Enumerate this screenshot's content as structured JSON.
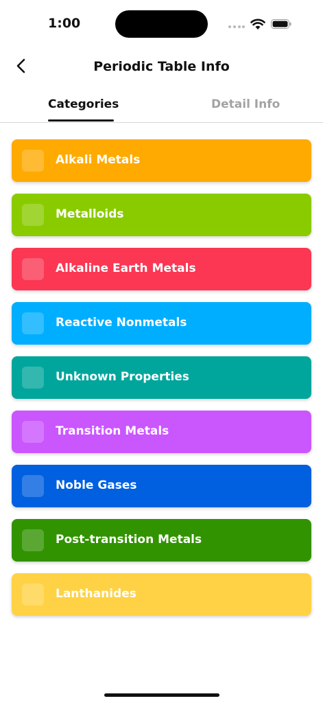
{
  "status_bar": {
    "time": "1:00"
  },
  "nav": {
    "title": "Periodic Table Info"
  },
  "tabs": [
    {
      "label": "Categories",
      "active": true
    },
    {
      "label": "Detail Info",
      "active": false
    }
  ],
  "categories": [
    {
      "label": "Alkali Metals",
      "color": "#FFAA00"
    },
    {
      "label": "Metalloids",
      "color": "#8ACB00"
    },
    {
      "label": "Alkaline Earth Metals",
      "color": "#FB3753"
    },
    {
      "label": "Reactive Nonmetals",
      "color": "#00AEFF"
    },
    {
      "label": "Unknown Properties",
      "color": "#00A69C"
    },
    {
      "label": "Transition Metals",
      "color": "#CA56FE"
    },
    {
      "label": "Noble Gases",
      "color": "#0060E0"
    },
    {
      "label": "Post-transition Metals",
      "color": "#319300"
    },
    {
      "label": "Lanthanides",
      "color": "#FFD245"
    }
  ]
}
